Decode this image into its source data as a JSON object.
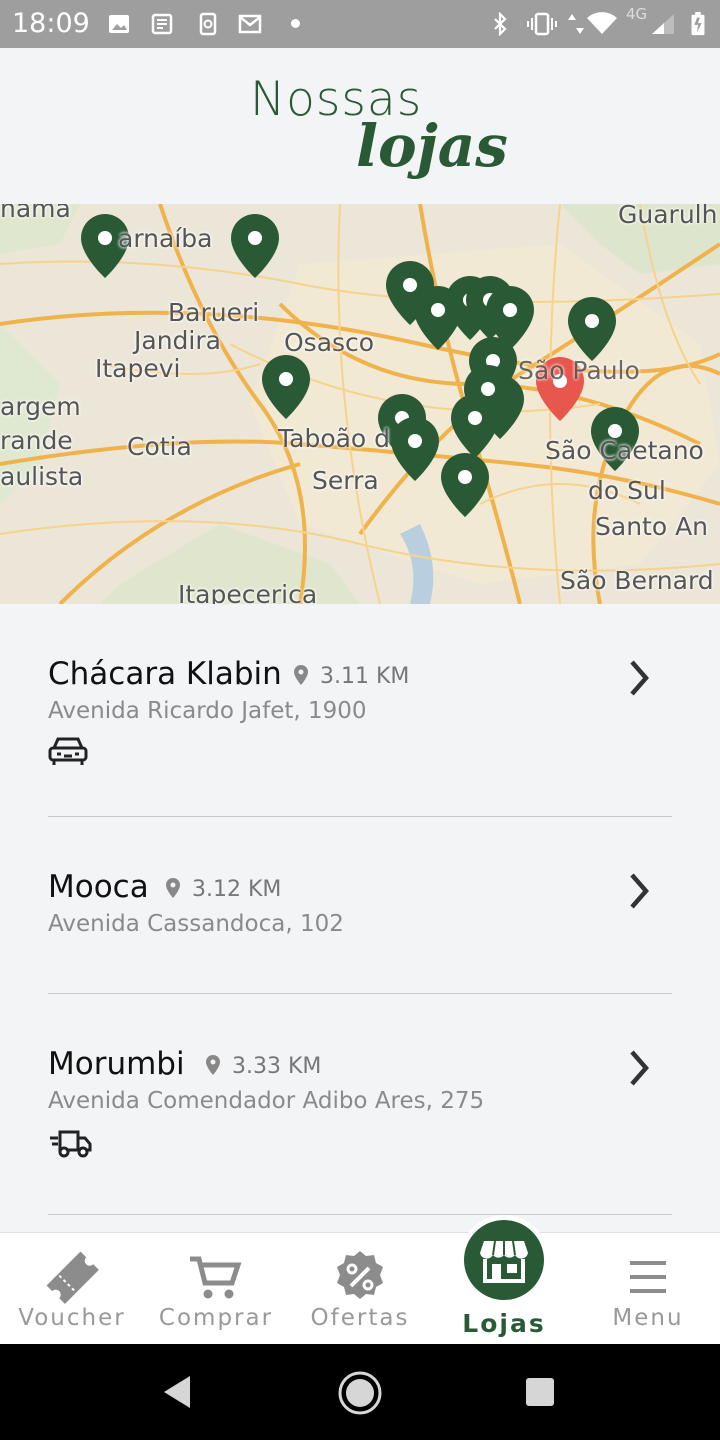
{
  "status_bar": {
    "time": "18:09",
    "network": "4G",
    "icons": [
      "image-icon",
      "news-icon",
      "phone-sync-icon",
      "gmail-icon",
      "bluetooth-icon",
      "vibrate-icon",
      "wifi-icon",
      "signal-icon",
      "battery-icon"
    ]
  },
  "header": {
    "title_line1": "Nossas",
    "title_line2": "lojas"
  },
  "map": {
    "labels": [
      "nama",
      "arnaíba",
      "Guarulh",
      "Barueri",
      "Jandira",
      "Osasco",
      "Itapevi",
      "argem",
      "rande",
      "aulista",
      "Cotia",
      "Taboão d",
      "Serra",
      "São Caetano",
      "do Sul",
      "Santo An",
      "São Bernard",
      "Itapecerica",
      "São Paulo"
    ],
    "marker_color": "#2a5a35",
    "current_marker_color": "#e8574d"
  },
  "stores": [
    {
      "name": "Chácara Klabin",
      "distance": "3.11 KM",
      "address": "Avenida Ricardo Jafet, 1900",
      "service_icon": "car-icon"
    },
    {
      "name": "Mooca",
      "distance": "3.12 KM",
      "address": "Avenida Cassandoca, 102",
      "service_icon": ""
    },
    {
      "name": "Morumbi",
      "distance": "3.33 KM",
      "address": "Avenida Comendador Adibo Ares, 275",
      "service_icon": "delivery-truck-icon"
    }
  ],
  "bottom_nav": {
    "items": [
      {
        "label": "Voucher",
        "icon": "ticket-icon"
      },
      {
        "label": "Comprar",
        "icon": "cart-icon"
      },
      {
        "label": "Ofertas",
        "icon": "percent-badge-icon"
      },
      {
        "label": "Lojas",
        "icon": "store-icon",
        "active": true
      },
      {
        "label": "Menu",
        "icon": "hamburger-icon"
      }
    ]
  },
  "colors": {
    "brand_green": "#2a5a35",
    "background": "#f3f4f6",
    "status_bar": "#9e9e9e"
  }
}
